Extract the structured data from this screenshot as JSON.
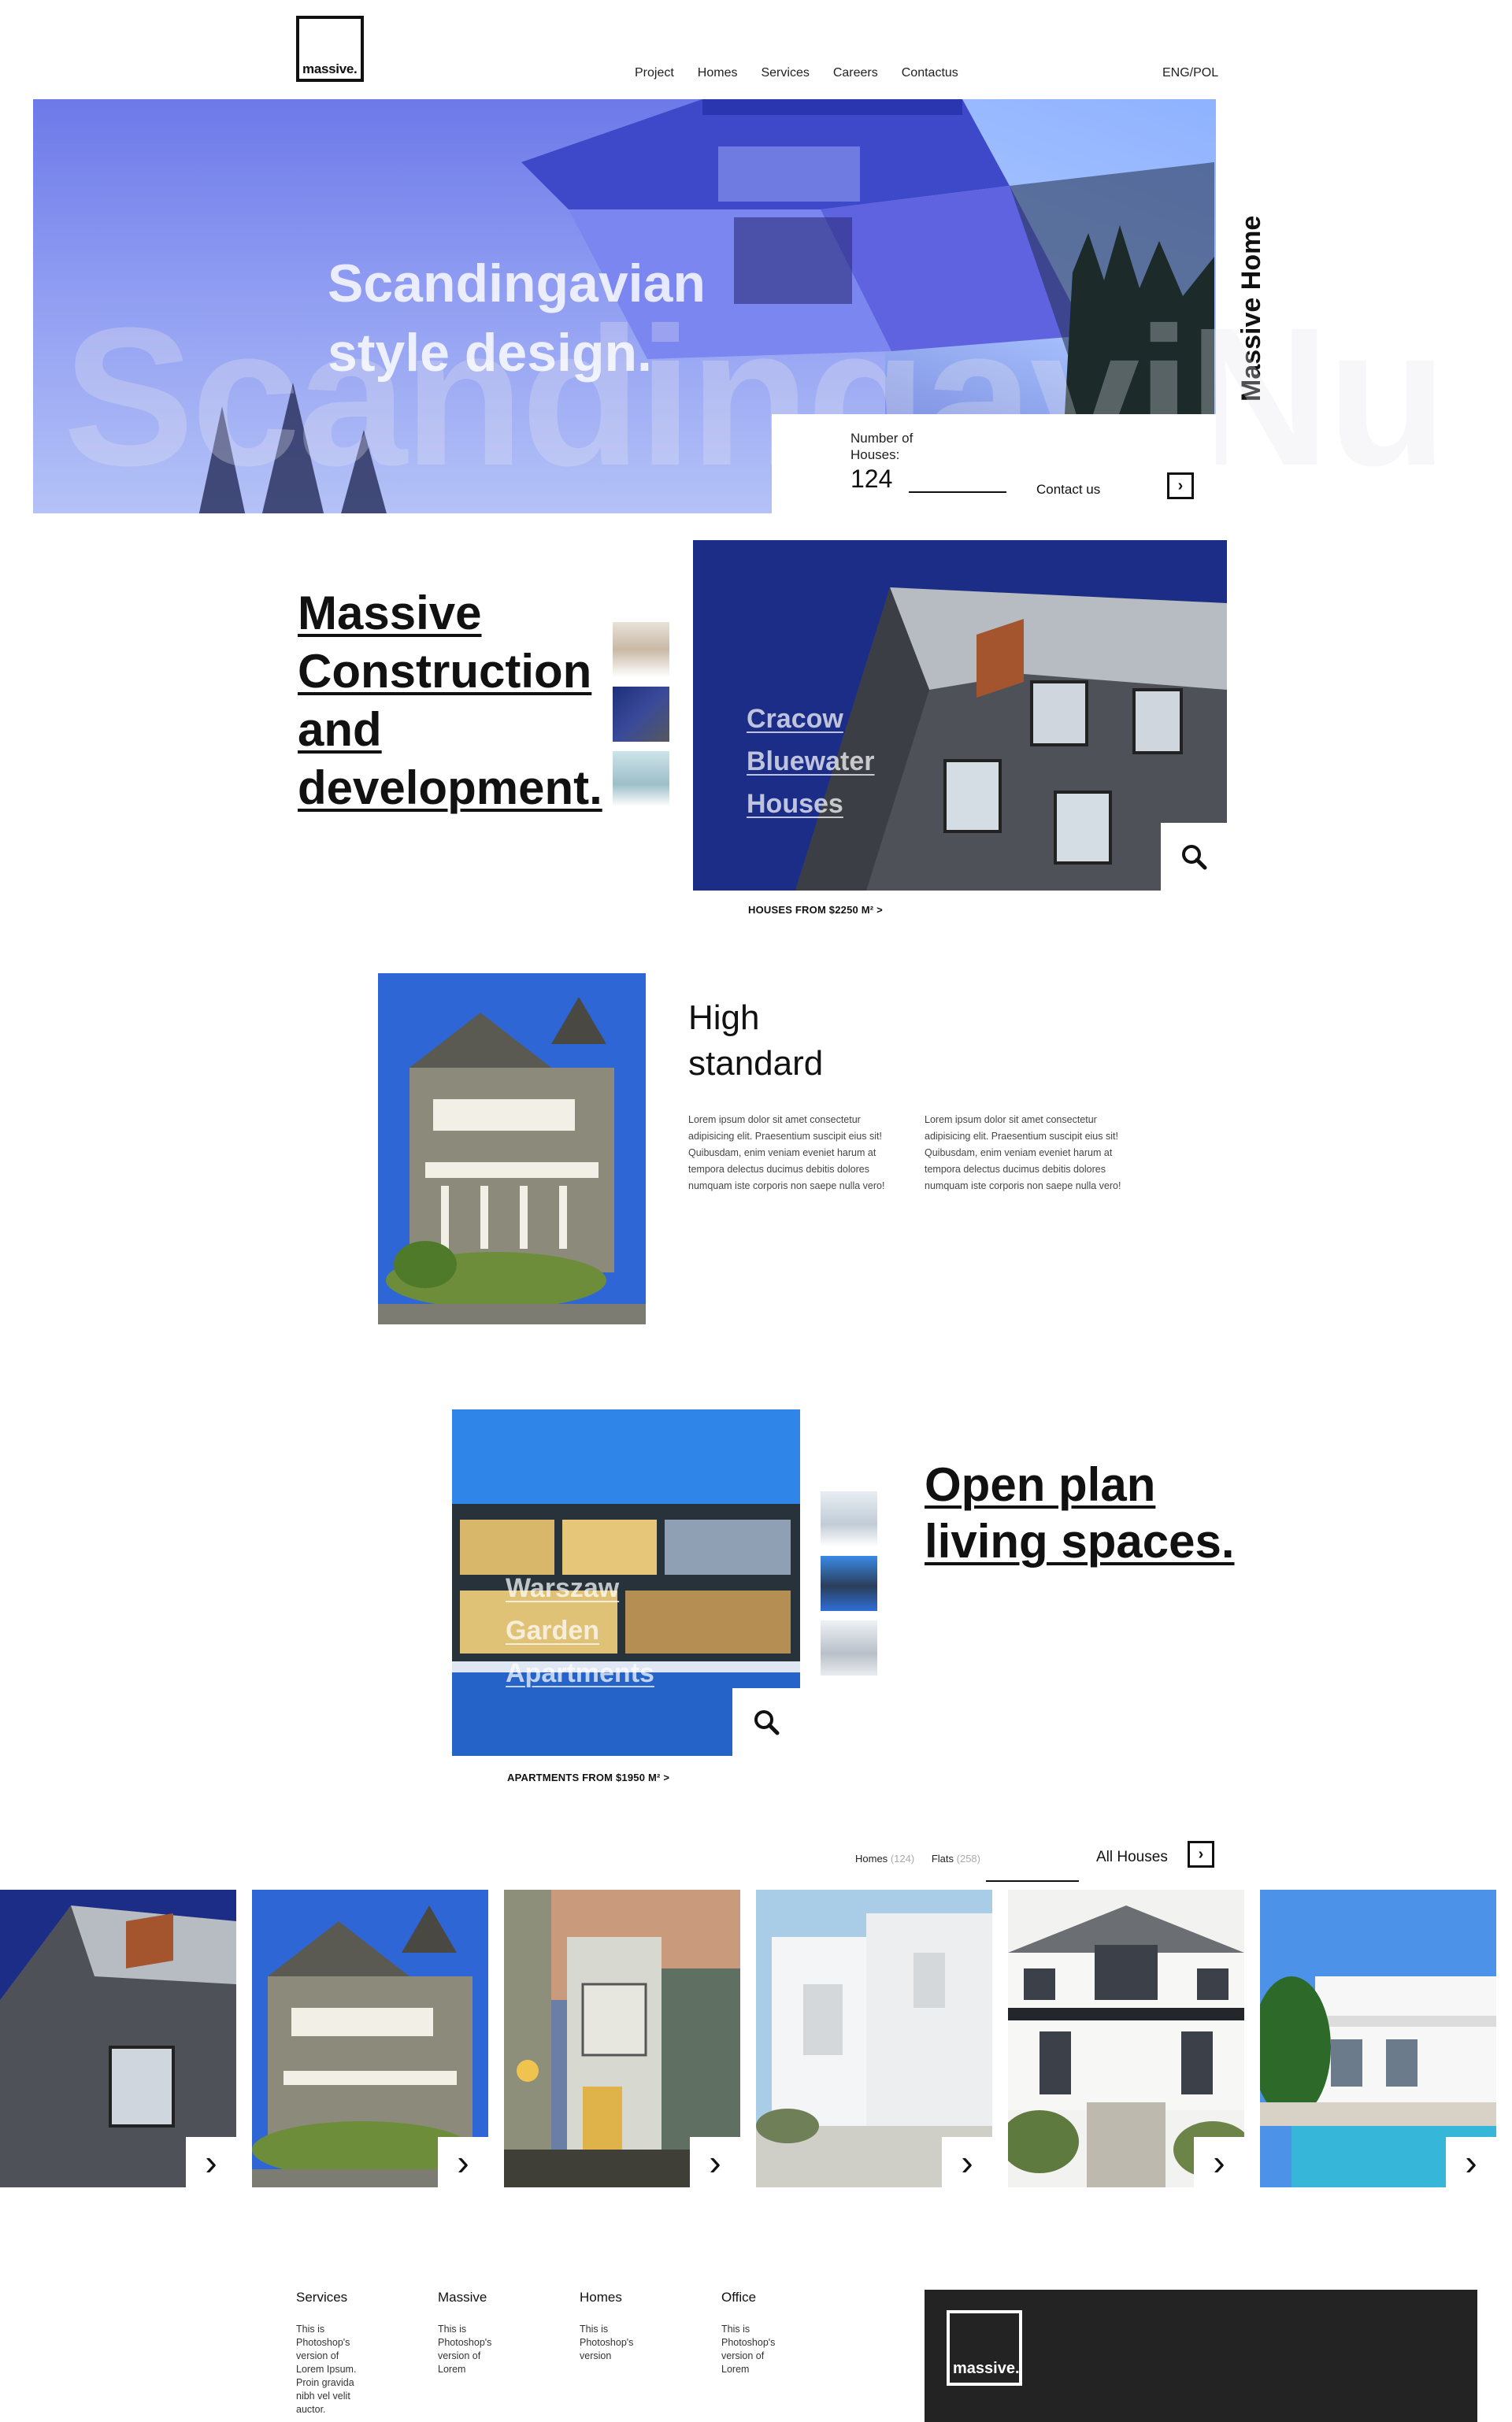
{
  "brand": {
    "logo_text": "massive."
  },
  "nav": {
    "items": [
      "Project",
      "Homes",
      "Services",
      "Careers",
      "Contactus"
    ],
    "language": "ENG/POL"
  },
  "hero": {
    "title_line1": "Scandingavian",
    "title_line2": "style design.",
    "watermark": "ScandingaviNu",
    "houses_label": "Number of Houses:",
    "houses_count": "124",
    "contact_label": "Contact us",
    "side_text": "Massive Home"
  },
  "section_construction": {
    "heading_lines": [
      "Massive",
      "Construction",
      "and",
      "development."
    ],
    "photo_label_lines": [
      "Cracow",
      "Bluewater",
      "Houses"
    ],
    "link": "HOUSES FROM $2250 M² >"
  },
  "section_standard": {
    "heading_lines": [
      "High",
      "standard"
    ],
    "paragraph_1": "Lorem ipsum dolor sit amet consectetur adipisicing elit. Praesentium suscipit eius sit! Quibusdam, enim veniam eveniet harum at tempora delectus ducimus debitis dolores numquam iste corporis non saepe nulla vero!",
    "paragraph_2": "Lorem ipsum dolor sit amet consectetur adipisicing elit. Praesentium suscipit eius sit! Quibusdam, enim veniam eveniet harum at tempora delectus ducimus debitis dolores numquam iste corporis non saepe nulla vero!"
  },
  "section_openplan": {
    "heading_lines": [
      "Open plan",
      "living spaces."
    ],
    "photo_label_lines": [
      "Warszaw",
      "Garden",
      "Apartments"
    ],
    "link": "APARTMENTS FROM $1950 M² >"
  },
  "gallery": {
    "filter_homes": "Homes",
    "filter_homes_count": "(124)",
    "filter_flats": "Flats",
    "filter_flats_count": "(258)",
    "all_label": "All Houses"
  },
  "footer": {
    "columns": [
      {
        "title": "Services",
        "lines": [
          "This is",
          "Photoshop's",
          "version of",
          "Lorem Ipsum.",
          "Proin gravida",
          "nibh vel velit",
          "auctor."
        ]
      },
      {
        "title": "Massive",
        "lines": [
          "This is",
          "Photoshop's",
          "version of",
          "Lorem"
        ]
      },
      {
        "title": "Homes",
        "lines": [
          "This is",
          "Photoshop's",
          "version"
        ]
      },
      {
        "title": "Office",
        "lines": [
          "This is",
          "Photoshop's",
          "version of",
          "Lorem"
        ]
      }
    ],
    "logo_text": "massive."
  },
  "colors": {
    "accent_dark": "#232323",
    "hero_blue": "#6d79e8",
    "sky_blue": "#2f6ee8"
  }
}
